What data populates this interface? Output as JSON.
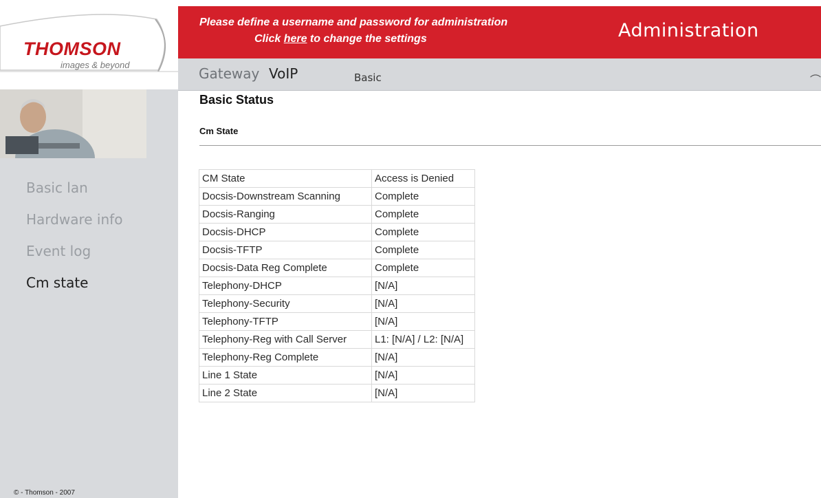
{
  "logo": {
    "brand": "THOMSON",
    "tagline": "images & beyond"
  },
  "banner": {
    "message_line1": "Please define a username and password for administration",
    "message_line2_pre": "Click ",
    "message_link": "here",
    "message_line2_post": " to change the settings",
    "title": "Administration"
  },
  "menu": {
    "gateway": "Gateway",
    "voip": "VoIP",
    "basic": "Basic"
  },
  "sidebar": {
    "items": [
      {
        "label": "Basic lan",
        "active": false
      },
      {
        "label": "Hardware info",
        "active": false
      },
      {
        "label": "Event log",
        "active": false
      },
      {
        "label": "Cm state",
        "active": true
      }
    ],
    "copyright": "© - Thomson - 2007"
  },
  "content": {
    "page_title": "Basic Status",
    "section_title": "Cm State",
    "rows": [
      {
        "label": "CM State",
        "value": "Access is Denied"
      },
      {
        "label": "Docsis-Downstream Scanning",
        "value": "Complete"
      },
      {
        "label": "Docsis-Ranging",
        "value": "Complete"
      },
      {
        "label": "Docsis-DHCP",
        "value": "Complete"
      },
      {
        "label": "Docsis-TFTP",
        "value": "Complete"
      },
      {
        "label": "Docsis-Data Reg Complete",
        "value": "Complete"
      },
      {
        "label": "Telephony-DHCP",
        "value": "[N/A]"
      },
      {
        "label": "Telephony-Security",
        "value": "[N/A]"
      },
      {
        "label": "Telephony-TFTP",
        "value": "[N/A]"
      },
      {
        "label": "Telephony-Reg with Call Server",
        "value": "L1: [N/A] / L2: [N/A]"
      },
      {
        "label": "Telephony-Reg Complete",
        "value": "[N/A]"
      },
      {
        "label": "Line 1 State",
        "value": "[N/A]"
      },
      {
        "label": "Line 2 State",
        "value": "[N/A]"
      }
    ]
  },
  "colors": {
    "brand_red": "#d4202a",
    "sidebar_bg": "#d8dadd",
    "nav_inactive": "#9a9ea3"
  }
}
